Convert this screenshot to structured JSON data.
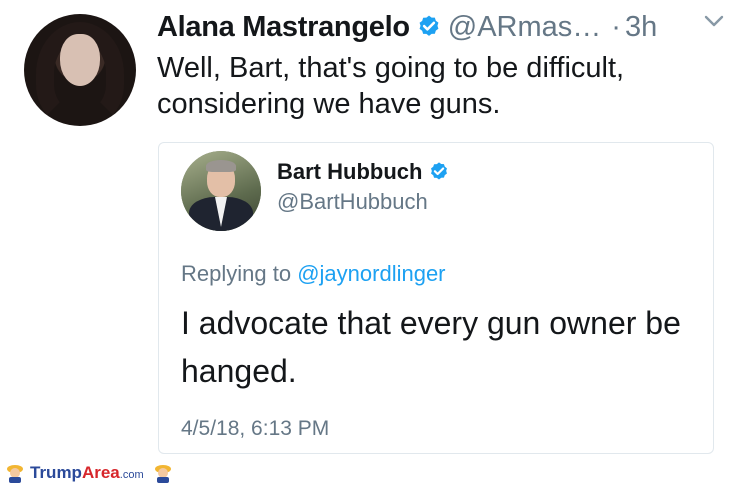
{
  "tweet": {
    "author_name": "Alana Mastrangelo",
    "author_handle": "@ARmas…",
    "separator": "·",
    "time": "3h",
    "text": "Well, Bart, that's going to be difficult, considering we have guns.",
    "verified_icon": "verified-badge-icon",
    "menu_icon": "chevron-down-icon",
    "colors": {
      "accent": "#1da1f2",
      "secondary_text": "#657786",
      "primary_text": "#14171a",
      "border": "#e1e8ed"
    }
  },
  "quoted_tweet": {
    "author_name": "Bart Hubbuch",
    "author_handle": "@BartHubbuch",
    "replying_prefix": "Replying to",
    "replying_to": "@jaynordlinger",
    "text": "I advocate that every gun owner be hanged.",
    "date": "4/5/18, 6:13 PM"
  },
  "footer": {
    "brand_main": "Trump",
    "brand_accent": "Area",
    "brand_suffix": ".com",
    "colors": {
      "blue": "#2b4a9a",
      "red": "#d7262b"
    }
  }
}
